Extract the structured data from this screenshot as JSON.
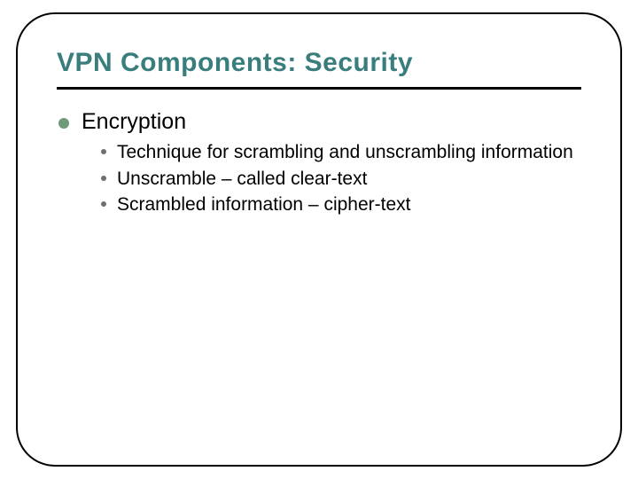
{
  "title": "VPN Components: Security",
  "lvl1": {
    "text": "Encryption"
  },
  "lvl2": [
    {
      "text": "Technique for scrambling and unscrambling information"
    },
    {
      "text": "Unscramble – called clear-text"
    },
    {
      "text": "Scrambled information – cipher-text"
    }
  ]
}
